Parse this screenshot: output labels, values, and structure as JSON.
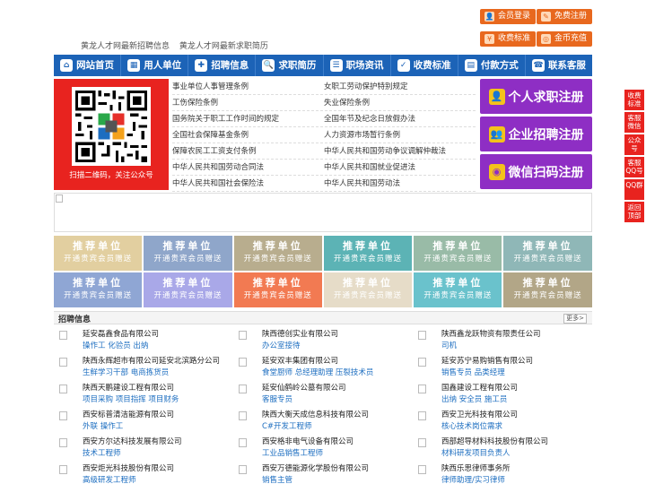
{
  "top_buttons": [
    {
      "label": "会员登录",
      "icon": "member-login-icon",
      "glyph": "👤"
    },
    {
      "label": "免费注册",
      "icon": "free-register-icon",
      "glyph": "✎"
    },
    {
      "label": "收费标准",
      "icon": "fee-standard-icon",
      "glyph": "¥"
    },
    {
      "label": "金币充值",
      "icon": "coin-recharge-icon",
      "glyph": "◎"
    }
  ],
  "taglines": [
    "黄龙人才网最新招聘信息",
    "黄龙人才网最新求职简历"
  ],
  "nav": [
    {
      "label": "网站首页",
      "icon": "home-icon",
      "glyph": "⌂"
    },
    {
      "label": "用人单位",
      "icon": "building-icon",
      "glyph": "▦"
    },
    {
      "label": "招聘信息",
      "icon": "recruit-icon",
      "glyph": "✚"
    },
    {
      "label": "求职简历",
      "icon": "resume-icon",
      "glyph": "🔍"
    },
    {
      "label": "职场资讯",
      "icon": "news-icon",
      "glyph": "☰"
    },
    {
      "label": "收费标准",
      "icon": "fee-icon",
      "glyph": "✓"
    },
    {
      "label": "付款方式",
      "icon": "payment-icon",
      "glyph": "▤"
    },
    {
      "label": "联系客服",
      "icon": "phone-icon",
      "glyph": "☎"
    }
  ],
  "qr": {
    "caption": "扫描二维码，关注公众号"
  },
  "laws": [
    [
      "事业单位人事管理条例",
      "女职工劳动保护特别规定"
    ],
    [
      "工伤保险条例",
      "失业保险条例"
    ],
    [
      "国务院关于职工工作时间的规定",
      "全国年节及纪念日放假办法"
    ],
    [
      "全国社会保障基金条例",
      "人力资源市场暂行条例"
    ],
    [
      "保障农民工工资支付条例",
      "中华人民共和国劳动争议调解仲裁法"
    ],
    [
      "中华人民共和国劳动合同法",
      "中华人民共和国就业促进法"
    ],
    [
      "中华人民共和国社会保险法",
      "中华人民共和国劳动法"
    ]
  ],
  "register_buttons": [
    {
      "label": "个人求职注册",
      "icon": "person-icon",
      "glyph": "👤"
    },
    {
      "label": "企业招聘注册",
      "icon": "company-icon",
      "glyph": "👥"
    },
    {
      "label": "微信扫码注册",
      "icon": "wechat-icon",
      "glyph": "◉"
    }
  ],
  "tiles": {
    "title": "推荐单位",
    "subtitle": "开通贵宾会员赠送",
    "colors": [
      [
        "#e2cfa0",
        "#8fa6ca",
        "#b8ad8e",
        "#5cb3b5",
        "#99bba7",
        "#8fb7b7"
      ],
      [
        "#8fa6d4",
        "#a9a8e8",
        "#f27a52",
        "#e6dcc8",
        "#6ac2cc",
        "#b2a687"
      ]
    ]
  },
  "jobs_section": {
    "title": "招聘信息",
    "more": "更多>"
  },
  "jobs": [
    {
      "company": "延安磊鑫食品有限公司",
      "positions": "操作工 化验员 出纳"
    },
    {
      "company": "陕西德创实业有限公司",
      "positions": "办公室接待"
    },
    {
      "company": "陕西鑫龙跃物资有限责任公司",
      "positions": "司机"
    },
    {
      "company": "陕西永辉超市有限公司延安北滨路分公司",
      "positions": "生鲜学习干部 电商拣货员"
    },
    {
      "company": "延安双丰集团有限公司",
      "positions": "食堂厨师 总经理助理 压裂技术员"
    },
    {
      "company": "延安苏宁易购销售有限公司",
      "positions": "销售专员 品类经理"
    },
    {
      "company": "陕西天鹏建设工程有限公司",
      "positions": "项目采购 项目指挥 项目财务"
    },
    {
      "company": "延安仙鹤岭公墓有限公司",
      "positions": "客服专员"
    },
    {
      "company": "国鑫建设工程有限公司",
      "positions": "出纳 安全员 施工员"
    },
    {
      "company": "西安标普清洁能源有限公司",
      "positions": "外联 操作工"
    },
    {
      "company": "陕西大衡天成信息科技有限公司",
      "positions": "C#开发工程师"
    },
    {
      "company": "西安卫光科技有限公司",
      "positions": "核心技术岗位需求"
    },
    {
      "company": "西安方尔达科技发展有限公司",
      "positions": "技术工程师"
    },
    {
      "company": "西安格非电气设备有限公司",
      "positions": "工业品销售工程师"
    },
    {
      "company": "西部超导材料科技股份有限公司",
      "positions": "材料研发项目负责人"
    },
    {
      "company": "西安炬光科技股份有限公司",
      "positions": "高级研发工程师"
    },
    {
      "company": "西安万德能源化学股份有限公司",
      "positions": "销售主管"
    },
    {
      "company": "陕西乐思律师事务所",
      "positions": "律师助理/实习律师"
    }
  ],
  "side_buttons": [
    "收费标准",
    "客服微信",
    "公众号",
    "客服QQ号",
    "QQ群",
    "返回顶部"
  ]
}
